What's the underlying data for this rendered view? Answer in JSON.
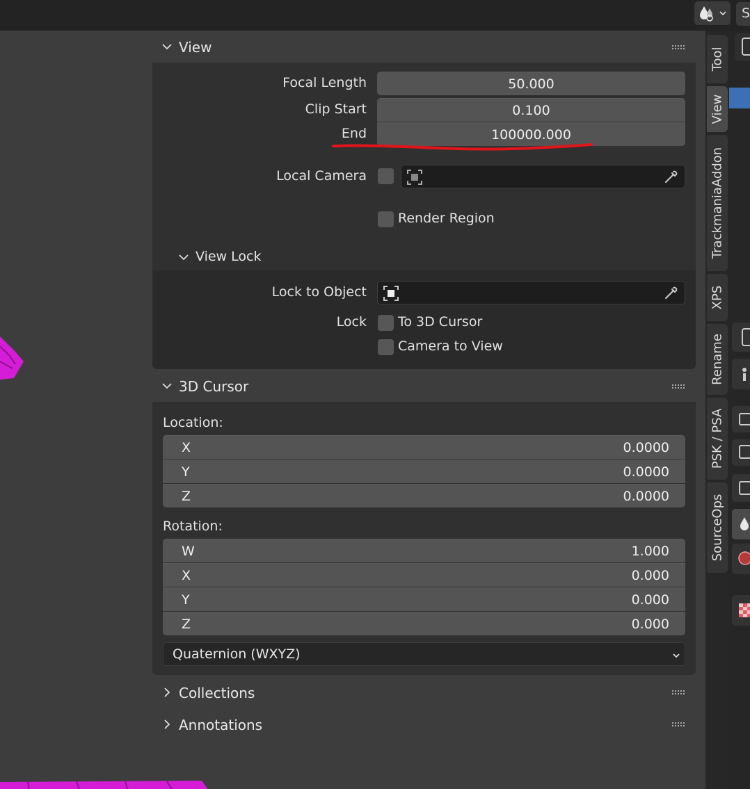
{
  "topbar": {
    "right_label": "S"
  },
  "view_panel": {
    "title": "View",
    "focal_length_label": "Focal Length",
    "focal_length_value": "50.000",
    "clip_start_label": "Clip Start",
    "clip_start_value": "0.100",
    "clip_end_label": "End",
    "clip_end_value": "100000.000",
    "local_camera_label": "Local Camera",
    "render_region_label": "Render Region",
    "view_lock": {
      "title": "View Lock",
      "lock_to_object_label": "Lock to Object",
      "lock_label": "Lock",
      "to_3d_cursor_label": "To 3D Cursor",
      "camera_to_view_label": "Camera to View"
    }
  },
  "cursor_panel": {
    "title": "3D Cursor",
    "location_label": "Location:",
    "location": [
      {
        "axis": "X",
        "value": "0.0000"
      },
      {
        "axis": "Y",
        "value": "0.0000"
      },
      {
        "axis": "Z",
        "value": "0.0000"
      }
    ],
    "rotation_label": "Rotation:",
    "rotation": [
      {
        "axis": "W",
        "value": "1.000"
      },
      {
        "axis": "X",
        "value": "0.000"
      },
      {
        "axis": "Y",
        "value": "0.000"
      },
      {
        "axis": "Z",
        "value": "0.000"
      }
    ],
    "rotation_mode": "Quaternion (WXYZ)"
  },
  "collections_panel": {
    "title": "Collections"
  },
  "annotations_panel": {
    "title": "Annotations"
  },
  "tabs": [
    "Tool",
    "View",
    "TrackmaniaAddon",
    "XPS",
    "Rename",
    "PSK / PSA",
    "SourceOps"
  ],
  "colors": {
    "annotation_stroke": "#e0151b",
    "mesh": "#d51dd8",
    "accent_blue": "#3d6fb5"
  }
}
